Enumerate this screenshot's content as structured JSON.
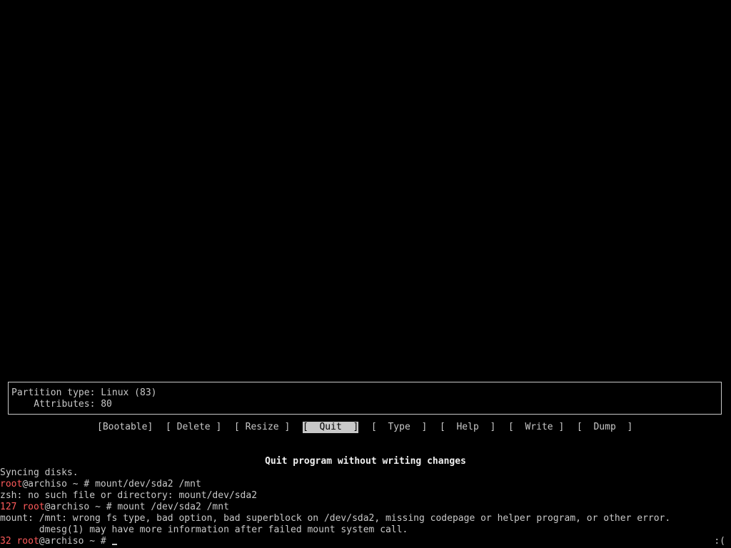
{
  "partition_info": {
    "type_line": "Partition type: Linux (83)",
    "attributes_line": "    Attributes: 80"
  },
  "menu": {
    "items": [
      {
        "label": "[Bootable]",
        "selected": false
      },
      {
        "label": "[ Delete ]",
        "selected": false
      },
      {
        "label": "[ Resize ]",
        "selected": false
      },
      {
        "label": "[  Quit  ]",
        "selected": true
      },
      {
        "label": "[  Type  ]",
        "selected": false
      },
      {
        "label": "[  Help  ]",
        "selected": false
      },
      {
        "label": "[  Write ]",
        "selected": false
      },
      {
        "label": "[  Dump  ]",
        "selected": false
      }
    ],
    "description": "Quit program without writing changes"
  },
  "console": {
    "line1": "Syncing disks.",
    "line2": {
      "user": "root",
      "host": "@archiso ~ # ",
      "command": "mount/dev/sda2 /mnt"
    },
    "line3": "zsh: no such file or directory: mount/dev/sda2",
    "line4": {
      "status": "127 ",
      "user": "root",
      "host": "@archiso ~ # ",
      "command": "mount /dev/sda2 /mnt"
    },
    "line5": "mount: /mnt: wrong fs type, bad option, bad superblock on /dev/sda2, missing codepage or helper program, or other error.",
    "line6": "       dmesg(1) may have more information after failed mount system call.",
    "line7": {
      "status": "32 ",
      "user": "root",
      "host": "@archiso ~ # "
    },
    "right_prompt": ":("
  },
  "colors": {
    "background": "#000000",
    "foreground": "#c8c8c8",
    "prompt_red": "#ff5b5b"
  }
}
